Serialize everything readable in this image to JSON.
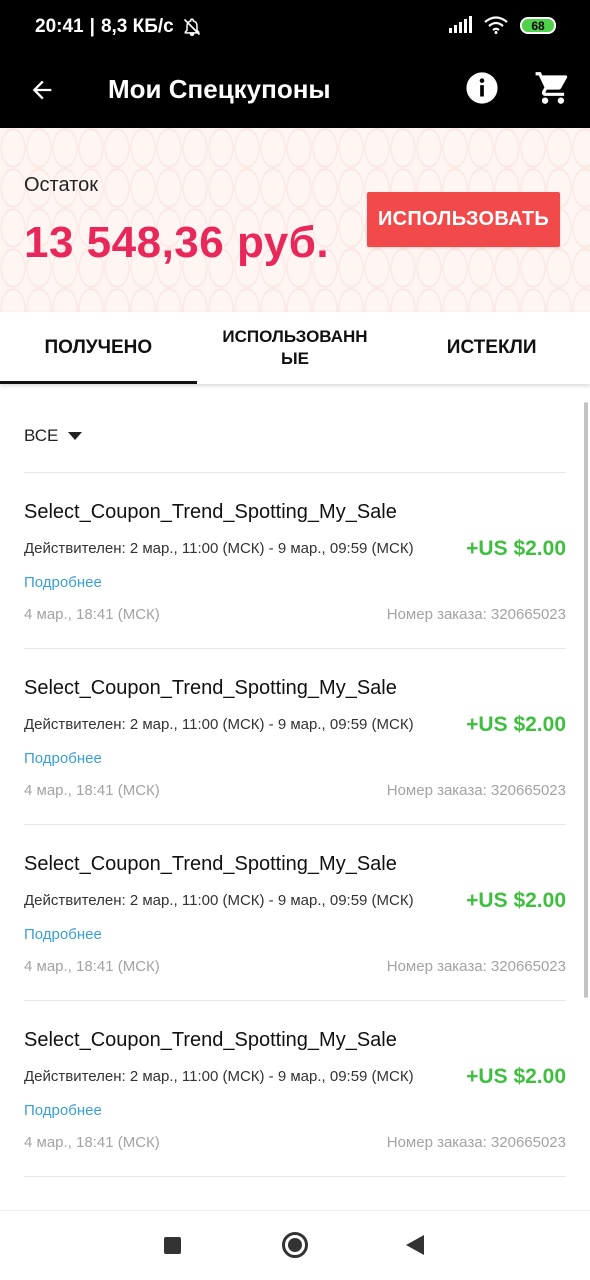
{
  "status_bar": {
    "time": "20:41",
    "separator": "|",
    "speed": "8,3 КБ/с",
    "battery": "68"
  },
  "app_bar": {
    "title": "Мои Спецкупоны"
  },
  "balance": {
    "label": "Остаток",
    "amount": "13 548,36 руб.",
    "use_button": "ИСПОЛЬЗОВАТЬ"
  },
  "tabs": [
    {
      "label": "ПОЛУЧЕНО",
      "active": true
    },
    {
      "label": "ИСПОЛЬЗОВАННЫЕ",
      "active": false
    },
    {
      "label": "ИСТЕКЛИ",
      "active": false
    }
  ],
  "filter": {
    "label": "ВСЕ"
  },
  "coupons": [
    {
      "name": "Select_Coupon_Trend_Spotting_My_Sale",
      "validity": "Действителен: 2 мар., 11:00 (МСК) - 9 мар., 09:59 (МСК)",
      "amount": "+US $2.00",
      "details": "Подробнее",
      "date": "4 мар., 18:41 (МСК)",
      "order": "Номер заказа: 320665023"
    },
    {
      "name": "Select_Coupon_Trend_Spotting_My_Sale",
      "validity": "Действителен: 2 мар., 11:00 (МСК) - 9 мар., 09:59 (МСК)",
      "amount": "+US $2.00",
      "details": "Подробнее",
      "date": "4 мар., 18:41 (МСК)",
      "order": "Номер заказа: 320665023"
    },
    {
      "name": "Select_Coupon_Trend_Spotting_My_Sale",
      "validity": "Действителен: 2 мар., 11:00 (МСК) - 9 мар., 09:59 (МСК)",
      "amount": "+US $2.00",
      "details": "Подробнее",
      "date": "4 мар., 18:41 (МСК)",
      "order": "Номер заказа: 320665023"
    },
    {
      "name": "Select_Coupon_Trend_Spotting_My_Sale",
      "validity": "Действителен: 2 мар., 11:00 (МСК) - 9 мар., 09:59 (МСК)",
      "amount": "+US $2.00",
      "details": "Подробнее",
      "date": "4 мар., 18:41 (МСК)",
      "order": "Номер заказа: 320665023"
    }
  ],
  "colors": {
    "balance_amount": "#e8285a",
    "use_button": "#f24a4a",
    "coupon_amount": "#3fbf3f",
    "details_link": "#3aa0d6"
  },
  "icons": {
    "back": "arrow-left-icon",
    "info": "info-icon",
    "cart": "cart-icon",
    "bell_off": "bell-off-icon",
    "signal": "signal-icon",
    "wifi": "wifi-icon",
    "battery": "battery-icon",
    "filter_caret": "caret-down-icon",
    "nav_recents": "square-icon",
    "nav_home": "circle-icon",
    "nav_back": "triangle-back-icon"
  }
}
